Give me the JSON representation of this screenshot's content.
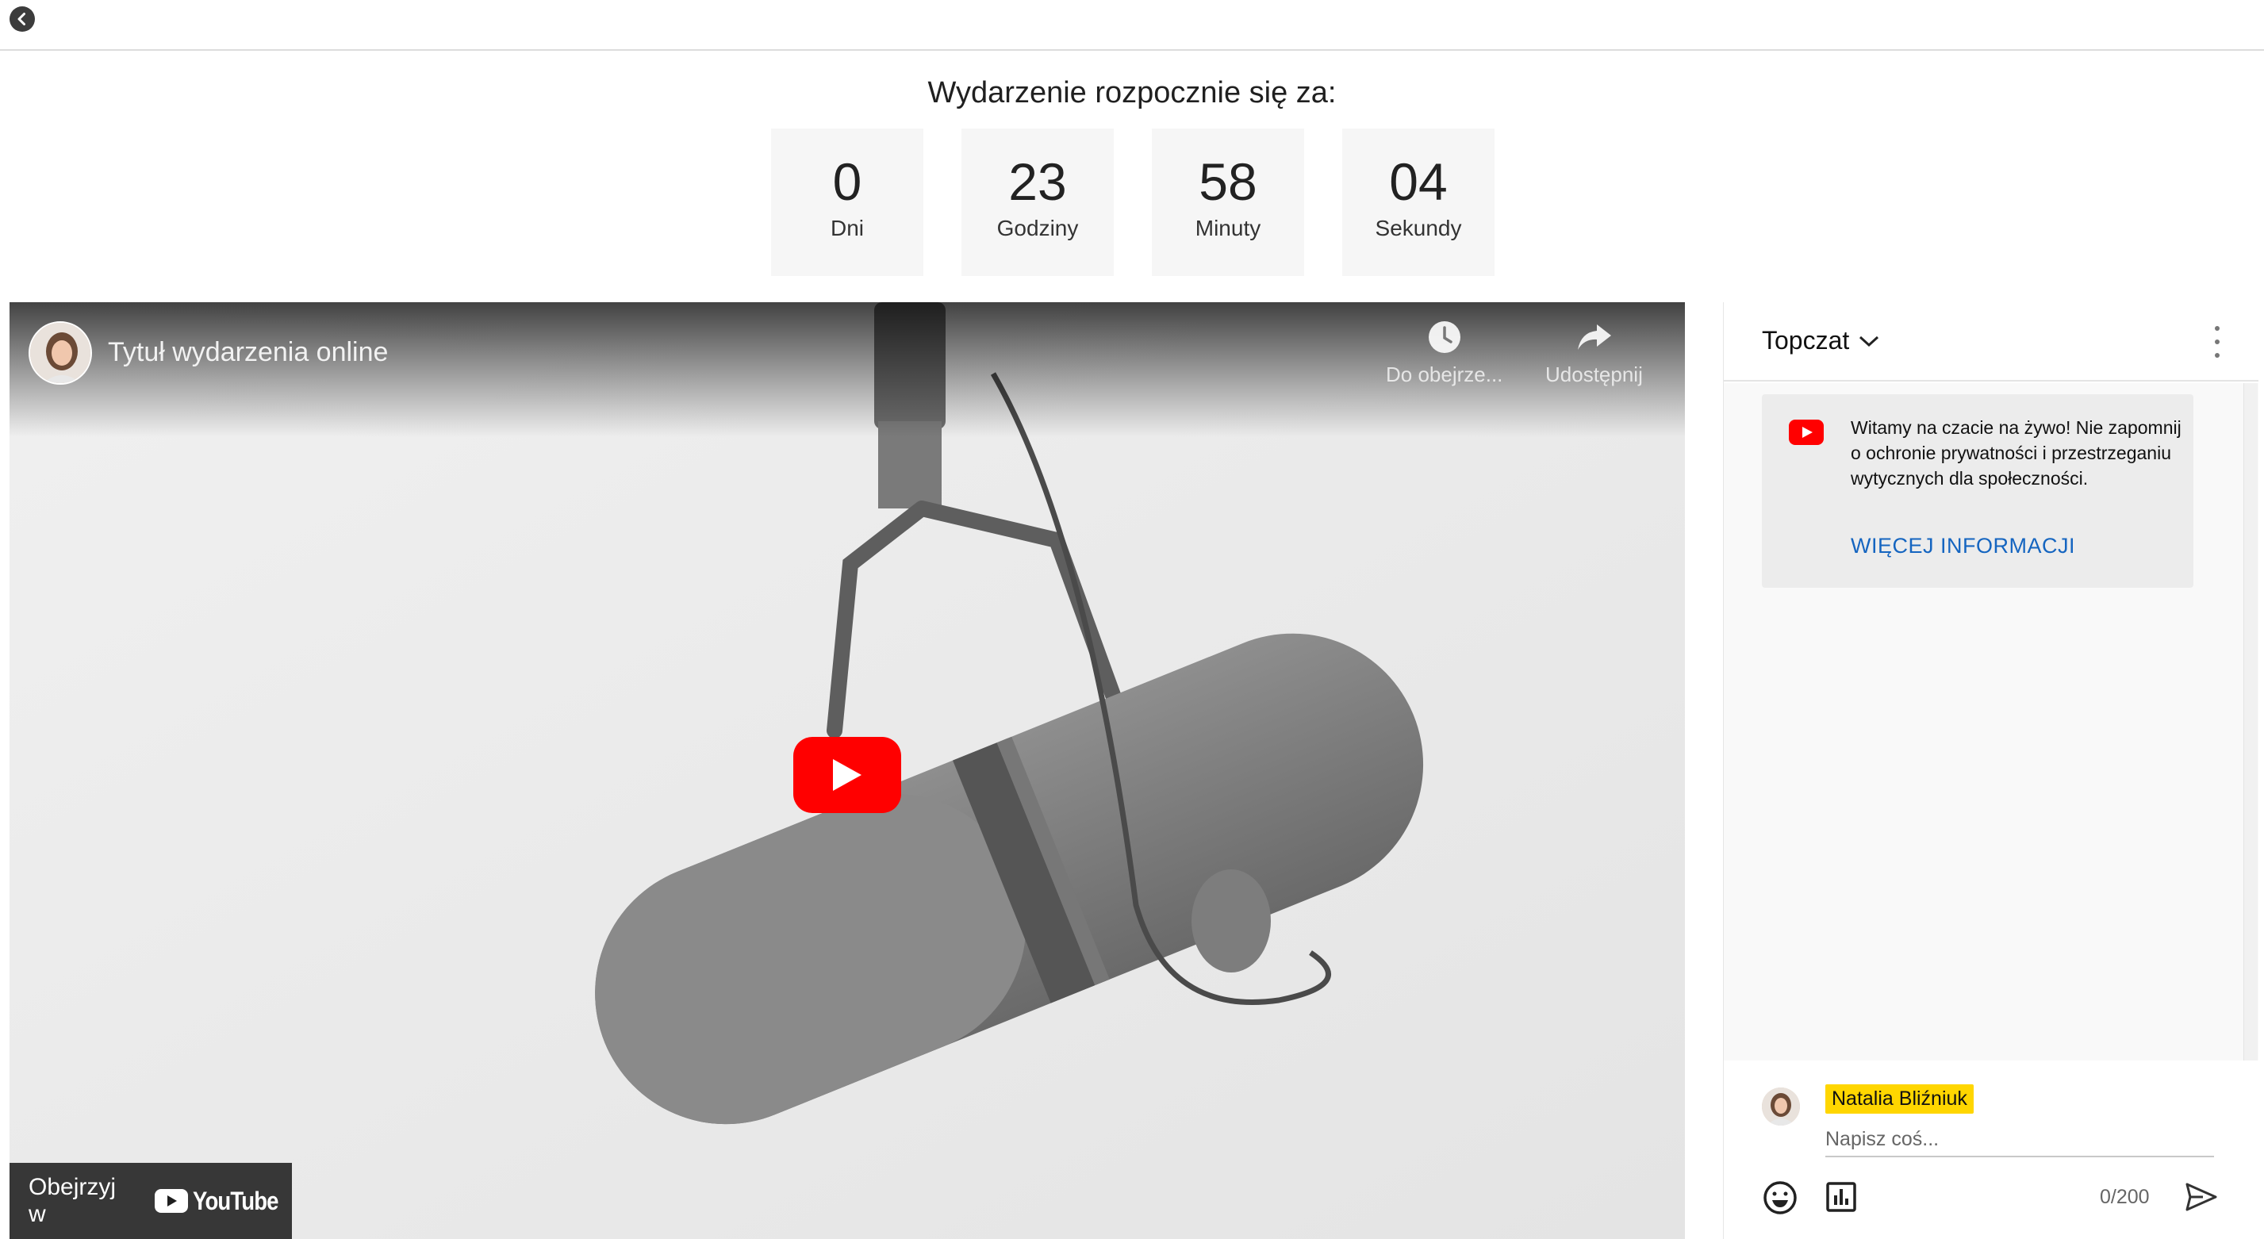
{
  "page": {
    "back_icon": "chevron-left-icon"
  },
  "countdown": {
    "title": "Wydarzenie rozpocznie się za:",
    "units": [
      {
        "value": "0",
        "label": "Dni"
      },
      {
        "value": "23",
        "label": "Godziny"
      },
      {
        "value": "58",
        "label": "Minuty"
      },
      {
        "value": "04",
        "label": "Sekundy"
      }
    ]
  },
  "video": {
    "title": "Tytuł wydarzenia online",
    "watch_later_label": "Do obejrze...",
    "watch_later_icon": "clock-icon",
    "share_label": "Udostępnij",
    "share_icon": "share-icon",
    "play_icon": "play-icon",
    "watch_on_label": "Obejrzyj w",
    "watch_on_brand": "YouTube",
    "brand_color": "#ff0000"
  },
  "chat": {
    "mode_label": "Topczat",
    "welcome_text": "Witamy na czacie na żywo! Nie zapomnij o ochronie prywatności i przestrzeganiu wytycznych dla społeczności.",
    "welcome_link": "WIĘCEJ INFORMACJI",
    "link_color": "#1565c0",
    "user_name": "Natalia Bliźniuk",
    "user_name_highlight": "#ffd600",
    "input_placeholder": "Napisz coś...",
    "char_count": "0/200"
  }
}
